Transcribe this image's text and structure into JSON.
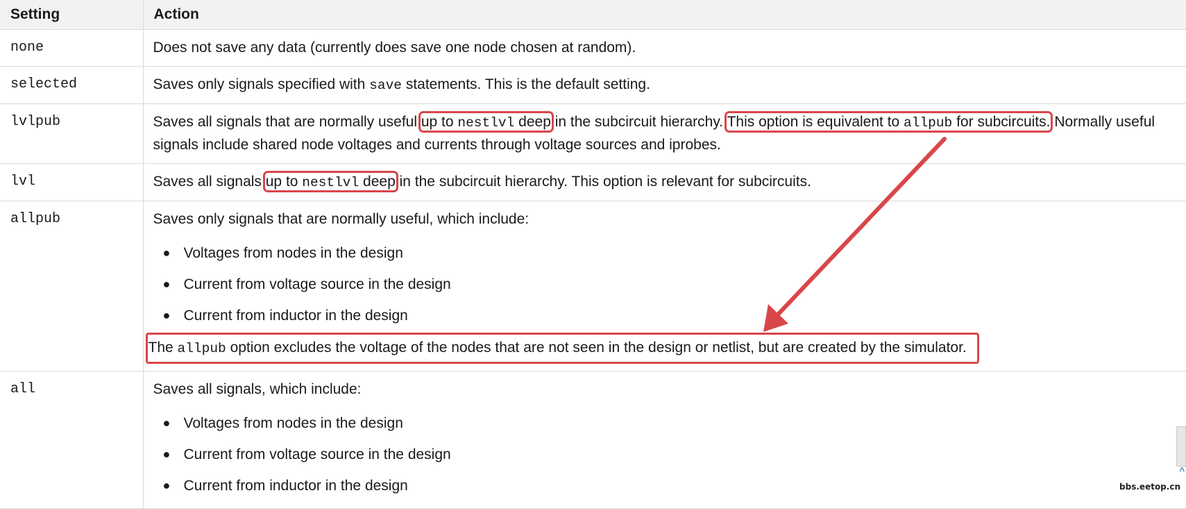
{
  "header": {
    "setting": "Setting",
    "action": "Action"
  },
  "rows": {
    "none": {
      "setting": "none",
      "action": "Does not save any data (currently does save one node chosen at random)."
    },
    "selected": {
      "setting": "selected",
      "t1": "Saves only signals specified with ",
      "code1": "save",
      "t2": " statements. This is the default setting."
    },
    "lvlpub": {
      "setting": "lvlpub",
      "t1": "Saves all signals that are normally useful ",
      "hl1_a": "up to ",
      "hl1_code": "nestlvl",
      "hl1_b": " deep",
      "t2": " in the subcircuit hierarchy. ",
      "hl2_a": "This option is equivalent to ",
      "hl2_code": "allpub",
      "hl2_b": " for subcircuits.",
      "t3": " Normally useful signals include shared node voltages and currents through voltage sources and iprobes."
    },
    "lvl": {
      "setting": "lvl",
      "t1": "Saves all signals ",
      "hl_a": "up to ",
      "hl_code": "nestlvl",
      "hl_b": " deep",
      "t2": " in the subcircuit hierarchy. This option is relevant for subcircuits."
    },
    "allpub": {
      "setting": "allpub",
      "intro": "Saves only signals that are normally useful, which include:",
      "items": [
        "Voltages from nodes in the design",
        "Current from voltage source in the design",
        "Current from inductor in the design"
      ],
      "note_a": "The ",
      "note_code": "allpub",
      "note_b": " option excludes the voltage of the nodes that are not seen in the design or netlist, but are created by the simulator."
    },
    "all": {
      "setting": "all",
      "intro": "Saves all signals, which include:",
      "items": [
        "Voltages from nodes in the design",
        "Current from voltage source in the design",
        "Current from inductor in the design"
      ]
    }
  },
  "annotation": {
    "color": "#d9464a"
  },
  "watermark": "bbs.eetop.cn"
}
